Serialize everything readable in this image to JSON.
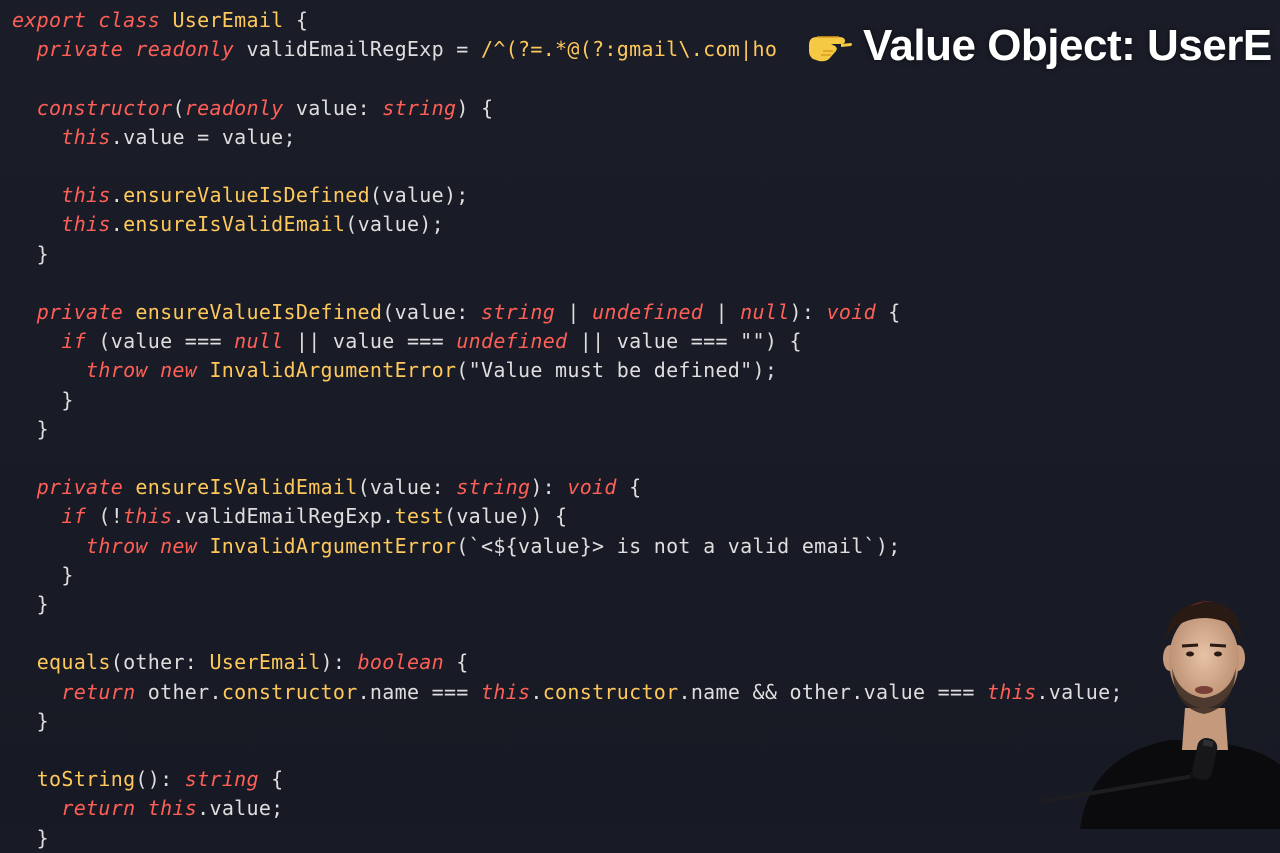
{
  "title_overlay": {
    "text": "Value Object: UserE",
    "hand_icon": "pointing-hand-icon"
  },
  "code": {
    "lines": [
      [
        {
          "t": "export class",
          "c": "kw"
        },
        {
          "t": " "
        },
        {
          "t": "UserEmail",
          "c": "fn"
        },
        {
          "t": " {"
        }
      ],
      [
        {
          "t": "  "
        },
        {
          "t": "private readonly",
          "c": "kw"
        },
        {
          "t": " validEmailRegExp = "
        },
        {
          "t": "/^(?=.*@(?:gmail\\.com|ho",
          "c": "fn"
        }
      ],
      [],
      [
        {
          "t": "  "
        },
        {
          "t": "constructor",
          "c": "kw"
        },
        {
          "t": "("
        },
        {
          "t": "readonly",
          "c": "kw"
        },
        {
          "t": " value: "
        },
        {
          "t": "string",
          "c": "kw"
        },
        {
          "t": ") {"
        }
      ],
      [
        {
          "t": "    "
        },
        {
          "t": "this",
          "c": "kw"
        },
        {
          "t": ".value = value;"
        }
      ],
      [],
      [
        {
          "t": "    "
        },
        {
          "t": "this",
          "c": "kw"
        },
        {
          "t": "."
        },
        {
          "t": "ensureValueIsDefined",
          "c": "fn"
        },
        {
          "t": "(value);"
        }
      ],
      [
        {
          "t": "    "
        },
        {
          "t": "this",
          "c": "kw"
        },
        {
          "t": "."
        },
        {
          "t": "ensureIsValidEmail",
          "c": "fn"
        },
        {
          "t": "(value);"
        }
      ],
      [
        {
          "t": "  }"
        }
      ],
      [],
      [
        {
          "t": "  "
        },
        {
          "t": "private",
          "c": "kw"
        },
        {
          "t": " "
        },
        {
          "t": "ensureValueIsDefined",
          "c": "fn"
        },
        {
          "t": "(value: "
        },
        {
          "t": "string",
          "c": "kw"
        },
        {
          "t": " | "
        },
        {
          "t": "undefined",
          "c": "kw"
        },
        {
          "t": " | "
        },
        {
          "t": "null",
          "c": "kw"
        },
        {
          "t": "): "
        },
        {
          "t": "void",
          "c": "kw"
        },
        {
          "t": " {"
        }
      ],
      [
        {
          "t": "    "
        },
        {
          "t": "if",
          "c": "kw"
        },
        {
          "t": " (value === "
        },
        {
          "t": "null",
          "c": "kw"
        },
        {
          "t": " || value === "
        },
        {
          "t": "undefined",
          "c": "kw"
        },
        {
          "t": " || value === \"\") {"
        }
      ],
      [
        {
          "t": "      "
        },
        {
          "t": "throw new",
          "c": "kw"
        },
        {
          "t": " "
        },
        {
          "t": "InvalidArgumentError",
          "c": "fn"
        },
        {
          "t": "(\"Value must be defined\");"
        }
      ],
      [
        {
          "t": "    }"
        }
      ],
      [
        {
          "t": "  }"
        }
      ],
      [],
      [
        {
          "t": "  "
        },
        {
          "t": "private",
          "c": "kw"
        },
        {
          "t": " "
        },
        {
          "t": "ensureIsValidEmail",
          "c": "fn"
        },
        {
          "t": "(value: "
        },
        {
          "t": "string",
          "c": "kw"
        },
        {
          "t": "): "
        },
        {
          "t": "void",
          "c": "kw"
        },
        {
          "t": " {"
        }
      ],
      [
        {
          "t": "    "
        },
        {
          "t": "if",
          "c": "kw"
        },
        {
          "t": " (!"
        },
        {
          "t": "this",
          "c": "kw"
        },
        {
          "t": ".validEmailRegExp."
        },
        {
          "t": "test",
          "c": "fn"
        },
        {
          "t": "(value)) {"
        }
      ],
      [
        {
          "t": "      "
        },
        {
          "t": "throw new",
          "c": "kw"
        },
        {
          "t": " "
        },
        {
          "t": "InvalidArgumentError",
          "c": "fn"
        },
        {
          "t": "(`<${value}> is not a valid email`);"
        }
      ],
      [
        {
          "t": "    }"
        }
      ],
      [
        {
          "t": "  }"
        }
      ],
      [],
      [
        {
          "t": "  "
        },
        {
          "t": "equals",
          "c": "fn"
        },
        {
          "t": "(other: "
        },
        {
          "t": "UserEmail",
          "c": "fn"
        },
        {
          "t": "): "
        },
        {
          "t": "boolean",
          "c": "kw"
        },
        {
          "t": " {"
        }
      ],
      [
        {
          "t": "    "
        },
        {
          "t": "return",
          "c": "kw"
        },
        {
          "t": " other."
        },
        {
          "t": "constructor",
          "c": "fn"
        },
        {
          "t": ".name === "
        },
        {
          "t": "this",
          "c": "kw"
        },
        {
          "t": "."
        },
        {
          "t": "constructor",
          "c": "fn"
        },
        {
          "t": ".name && other.value === "
        },
        {
          "t": "this",
          "c": "kw"
        },
        {
          "t": ".value;"
        }
      ],
      [
        {
          "t": "  }"
        }
      ],
      [],
      [
        {
          "t": "  "
        },
        {
          "t": "toString",
          "c": "fn"
        },
        {
          "t": "(): "
        },
        {
          "t": "string",
          "c": "kw"
        },
        {
          "t": " {"
        }
      ],
      [
        {
          "t": "    "
        },
        {
          "t": "return",
          "c": "kw"
        },
        {
          "t": " "
        },
        {
          "t": "this",
          "c": "kw"
        },
        {
          "t": ".value;"
        }
      ],
      [
        {
          "t": "  }"
        }
      ]
    ]
  },
  "colors": {
    "background": "#181b26",
    "keyword": "#ff5f56",
    "function": "#ffc85a",
    "text": "#dedede"
  }
}
